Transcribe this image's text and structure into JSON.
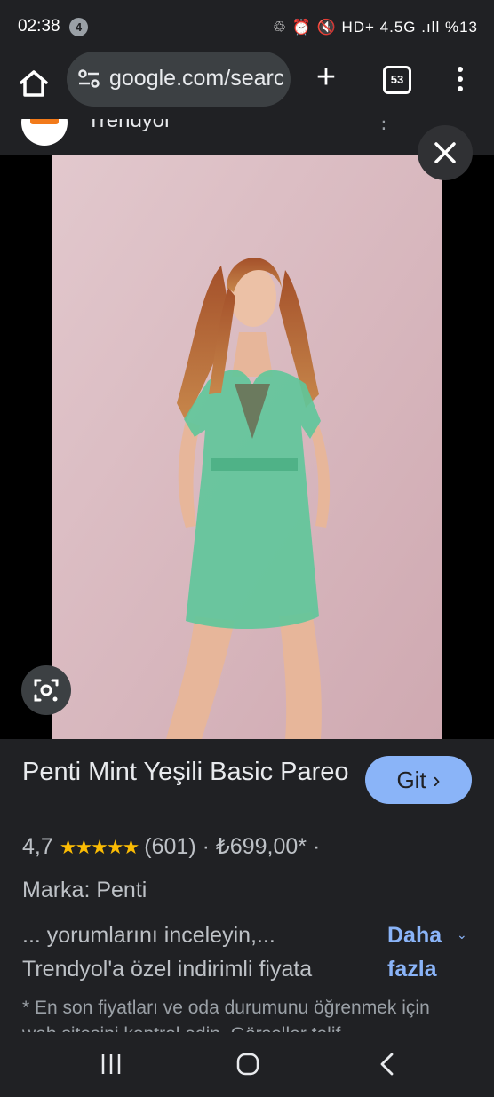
{
  "status_bar": {
    "time": "02:38",
    "notification_count": "4",
    "icons_text": "♲ ⏰ 🔇 HD+ 4.5G .ıll",
    "battery": "%13"
  },
  "toolbar": {
    "url": "google.com/search",
    "tab_count": "53"
  },
  "source": {
    "name": "Trendyol",
    "logo_text": "trendyol"
  },
  "product": {
    "title": "Penti Mint Yeşili Basic Pareo",
    "go_label": "Git ›",
    "rating": "4,7",
    "stars": "★★★★★",
    "reviews": "(601)",
    "price": "· ₺699,00* ·",
    "brand": "Marka: Penti",
    "description": "... yorumlarını inceleyin,... Trendyol'a özel indirimli fiyata",
    "more_label": "Daha fazla",
    "disclaimer": "* En son fiyatları ve oda durumunu öğrenmek için web sitesini kontrol edin. Görseller telif"
  },
  "colors": {
    "background": "#202124",
    "accent": "#8ab4f8",
    "star": "#fbbc04",
    "dress": "#5ec79a",
    "wall": "#d8b9c0"
  }
}
